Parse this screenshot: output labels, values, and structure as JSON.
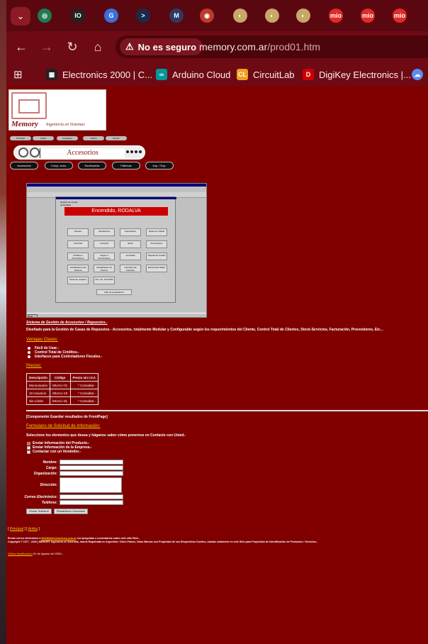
{
  "browser": {
    "tab_favicons": [
      {
        "name": "app-menu",
        "glyph": "⌄",
        "color": "#8d1a25"
      },
      {
        "name": "github-favicon",
        "glyph": "◎",
        "color": "#1f7a52"
      },
      {
        "name": "io-favicon",
        "glyph": "IO",
        "color": "#222222"
      },
      {
        "name": "translate-favicon",
        "glyph": "G",
        "color": "#3b6fd9"
      },
      {
        "name": "terminal-favicon",
        "glyph": ">",
        "color": "#1b2a48"
      },
      {
        "name": "m-favicon",
        "glyph": "M",
        "color": "#2e3a63"
      },
      {
        "name": "ring-favicon",
        "glyph": "◉",
        "color": "#c0392b"
      },
      {
        "name": "memory-favicon-1",
        "glyph": "◐",
        "color": "#c7a76a"
      },
      {
        "name": "memory-favicon-2",
        "glyph": "◐",
        "color": "#c7a76a"
      },
      {
        "name": "memory-favicon-3",
        "glyph": "◐",
        "color": "#c7a76a"
      },
      {
        "name": "mio-favicon-1",
        "glyph": "mio",
        "color": "#e02a2a"
      },
      {
        "name": "mio-favicon-2",
        "glyph": "mio",
        "color": "#e02a2a"
      },
      {
        "name": "mio-favicon-3",
        "glyph": "mio",
        "color": "#e02a2a"
      }
    ],
    "security_label": "No es seguro",
    "url_host": "memory.com.ar",
    "url_path": "/prod01.htm",
    "bookmarks": [
      {
        "label": "Electronics 2000 | C...",
        "icon": "electronics-icon",
        "color": "#222222",
        "glyph": "▦"
      },
      {
        "label": "Arduino Cloud",
        "icon": "arduino-icon",
        "color": "#00979d",
        "glyph": "∞"
      },
      {
        "label": "CircuitLab",
        "icon": "circuitlab-icon",
        "color": "#f0a020",
        "glyph": "CL"
      },
      {
        "label": "DigiKey Electronics |...",
        "icon": "digikey-icon",
        "color": "#cc0000",
        "glyph": "D"
      }
    ]
  },
  "page": {
    "logo_word": "Memory",
    "logo_sub": "Ingeniería en Sistemas",
    "banner_title": "Accesorios",
    "top_buttons": [
      "Principal",
      "Arriba",
      "Contactos",
      "Carrito",
      "Buscar"
    ],
    "pills": [
      "Accesorios",
      "Comp. Auto.",
      "Escribanías",
      "Fábricas",
      "Imp. / Exp."
    ],
    "screenshot": {
      "red_title": "Encendido, RODALVA",
      "header": "Gestión de Ventas\nde Rodalva",
      "buttons": [
        "Clientes",
        "Vendedores",
        "Facturación",
        "Notas de Crédito",
        "Sucursal",
        "Compras",
        "Stock",
        "Proveedores",
        "Pedidos a Proveedores",
        "Pagos a Proveedores",
        "Consultas",
        "Tarjetas de Crédito",
        "Actualización del Sistema",
        "Actualización de Precios",
        "Impresión de Facturas",
        "Estructuras Tablas",
        "Panel de Listados",
        "Cta. Cte. FACOMA",
        "Salir de la aplicación"
      ]
    },
    "desc_title": "Sistema de Gestión de Accesorios / Repuestos.-",
    "desc_text": "Diseñado para la Gestión de Casas de Repuestos - Accesorios, totalmente Modular y Configurable según los requerimientos del Cliente, Control Total de Clientes, Stock-Servicios, Facturación, Proveedores, Etc...",
    "advantages_title": "Ventajas Claves:",
    "advantages": [
      "Fácil de Usar.-",
      "Control Total de Créditos.-",
      "Interfaces para Controladores Fiscales.-"
    ],
    "prices_title": "Precios:",
    "price_headers": [
      "Descripción",
      "Código",
      "Precio sin I.V.A"
    ],
    "price_rows": [
      [
        "Monousuario",
        "MUAcc-01",
        "*  Consultar.-"
      ],
      [
        "10 Usuarios",
        "MUAcc-10",
        "*  Consultar.-"
      ],
      [
        "Sin Límite",
        "MUAcc-SL",
        "*  Consultar.-"
      ]
    ],
    "frontpage_note": "[Componente Guardar resultados de FrontPage]",
    "form_title": "Formulario de Solicitud de Información:",
    "form_intro": "Seleccione los elementos que desea y háganos saber cómo ponernos en Contacto con Usted.-",
    "checkboxes": [
      {
        "label": "Enviar Información del Producto.-",
        "checked": true
      },
      {
        "label": "Enviar Información de la Empresa.-",
        "checked": false
      },
      {
        "label": "Contactar con un Vendedor.-",
        "checked": false
      }
    ],
    "fields": [
      "Nombre:",
      "Cargo:",
      "Organización:",
      "Dirección:",
      "Correo Electrónico:",
      "Teléfono:"
    ],
    "submit_label": "Enviar Solicitud",
    "reset_label": "Restablecer formulario",
    "footer_nav_principal": "Principal",
    "footer_nav_arriba": "Arriba",
    "footer_line1_pre": "Enviar correo electrónico a ",
    "footer_line1_link": "WebMaster@memory.com.ar",
    "footer_line1_post": " con preguntas o comentarios sobre este sitio Web.-",
    "footer_line2": "Copyright © 1977 - 2026 [ MEMORY Ingeniería en Sistemas, marca Registrada en Argentina / Otros Países, Otras Marcas son Propiedad de sus Respectivos Dueños, usadas solamente en este Sitio para Propósitos de Identificación de Productos / Servicios.-",
    "footer_mod_link": "Última Modificación",
    "footer_mod_date": " 01 de Agosto del 2026.-"
  }
}
